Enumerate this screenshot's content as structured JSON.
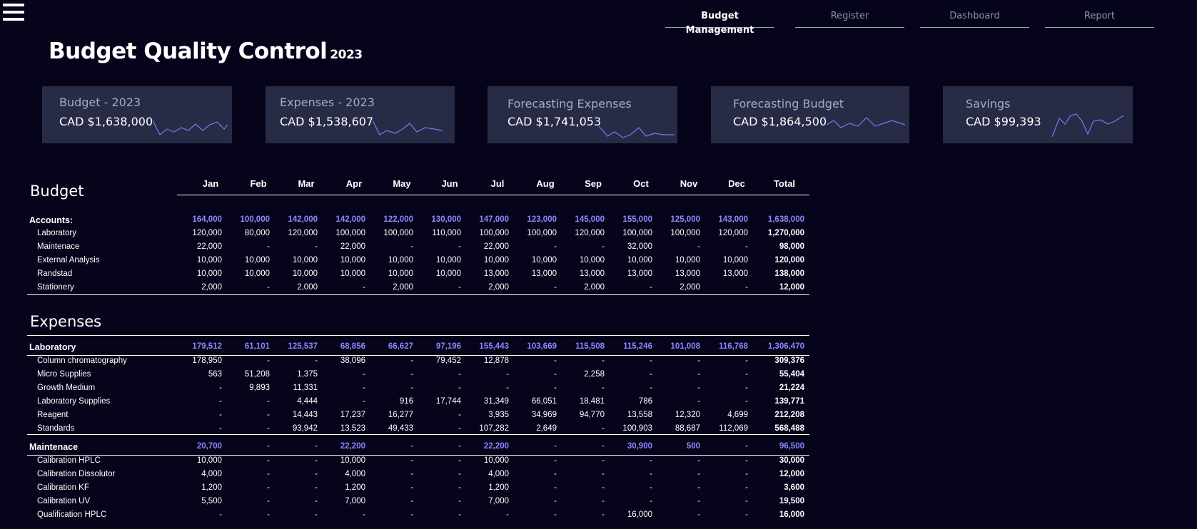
{
  "nav": [
    "Budget Management",
    "Register",
    "Dashboard",
    "Report"
  ],
  "title": "Budget Quality Control",
  "title_year": "2023",
  "accent_color": "#8c89ff",
  "kpis": [
    {
      "label": "Budget - 2023",
      "value": "CAD $1,638,000"
    },
    {
      "label": "Expenses - 2023",
      "value": "CAD $1,538,607"
    },
    {
      "label": "Forecasting Expenses",
      "value": "CAD $1,741,053"
    },
    {
      "label": "Forecasting Budget",
      "value": "CAD $1,864,500"
    },
    {
      "label": "Savings",
      "value": "CAD $99,393"
    }
  ],
  "months": [
    "Jan",
    "Feb",
    "Mar",
    "Apr",
    "May",
    "Jun",
    "Jul",
    "Aug",
    "Sep",
    "Oct",
    "Nov",
    "Dec",
    "Total"
  ],
  "budget": {
    "title": "Budget",
    "groups": [
      {
        "label": "Accounts:",
        "values": [
          "164,000",
          "100,000",
          "142,000",
          "142,000",
          "122,000",
          "130,000",
          "147,000",
          "123,000",
          "145,000",
          "155,000",
          "125,000",
          "143,000",
          "1,638,000"
        ],
        "rows": [
          {
            "label": "Laboratory",
            "values": [
              "120,000",
              "80,000",
              "120,000",
              "100,000",
              "100,000",
              "110,000",
              "100,000",
              "100,000",
              "120,000",
              "100,000",
              "100,000",
              "120,000",
              "1,270,000"
            ]
          },
          {
            "label": "Maintenace",
            "values": [
              "22,000",
              "-",
              "-",
              "22,000",
              "-",
              "-",
              "22,000",
              "-",
              "-",
              "32,000",
              "-",
              "-",
              "98,000"
            ]
          },
          {
            "label": "External Analysis",
            "values": [
              "10,000",
              "10,000",
              "10,000",
              "10,000",
              "10,000",
              "10,000",
              "10,000",
              "10,000",
              "10,000",
              "10,000",
              "10,000",
              "10,000",
              "120,000"
            ]
          },
          {
            "label": "Randstad",
            "values": [
              "10,000",
              "10,000",
              "10,000",
              "10,000",
              "10,000",
              "10,000",
              "13,000",
              "13,000",
              "13,000",
              "13,000",
              "13,000",
              "13,000",
              "138,000"
            ]
          },
          {
            "label": "Stationery",
            "values": [
              "2,000",
              "-",
              "2,000",
              "-",
              "2,000",
              "-",
              "2,000",
              "-",
              "2,000",
              "-",
              "2,000",
              "-",
              "12,000"
            ]
          }
        ]
      }
    ]
  },
  "expenses": {
    "title": "Expenses",
    "groups": [
      {
        "label": "Laboratory",
        "values": [
          "179,512",
          "61,101",
          "125,537",
          "68,856",
          "66,627",
          "97,196",
          "155,443",
          "103,669",
          "115,508",
          "115,246",
          "101,008",
          "116,768",
          "1,306,470"
        ],
        "rows": [
          {
            "label": "Column chromatography",
            "values": [
              "178,950",
              "-",
              "-",
              "38,096",
              "-",
              "79,452",
              "12,878",
              "-",
              "-",
              "-",
              "-",
              "-",
              "309,376"
            ]
          },
          {
            "label": "Micro Supplies",
            "values": [
              "563",
              "51,208",
              "1,375",
              "-",
              "-",
              "-",
              "-",
              "-",
              "2,258",
              "-",
              "-",
              "-",
              "55,404"
            ]
          },
          {
            "label": "Growth Medium",
            "values": [
              "-",
              "9,893",
              "11,331",
              "-",
              "-",
              "-",
              "-",
              "-",
              "-",
              "-",
              "-",
              "-",
              "21,224"
            ]
          },
          {
            "label": "Laboratory Supplies",
            "values": [
              "-",
              "-",
              "4,444",
              "-",
              "916",
              "17,744",
              "31,349",
              "66,051",
              "18,481",
              "786",
              "-",
              "-",
              "139,771"
            ]
          },
          {
            "label": "Reagent",
            "values": [
              "-",
              "-",
              "14,443",
              "17,237",
              "16,277",
              "-",
              "3,935",
              "34,969",
              "94,770",
              "13,558",
              "12,320",
              "4,699",
              "212,208"
            ]
          },
          {
            "label": "Standards",
            "values": [
              "-",
              "-",
              "93,942",
              "13,523",
              "49,433",
              "-",
              "107,282",
              "2,649",
              "-",
              "100,903",
              "88,687",
              "112,069",
              "568,488"
            ]
          }
        ]
      },
      {
        "label": "Maintenace",
        "values": [
          "20,700",
          "-",
          "-",
          "22,200",
          "-",
          "-",
          "22,200",
          "-",
          "-",
          "30,900",
          "500",
          "-",
          "96,500"
        ],
        "rows": [
          {
            "label": "Calibration HPLC",
            "values": [
              "10,000",
              "-",
              "-",
              "10,000",
              "-",
              "-",
              "10,000",
              "-",
              "-",
              "-",
              "-",
              "-",
              "30,000"
            ]
          },
          {
            "label": "Calibration Dissolutor",
            "values": [
              "4,000",
              "-",
              "-",
              "4,000",
              "-",
              "-",
              "4,000",
              "-",
              "-",
              "-",
              "-",
              "-",
              "12,000"
            ]
          },
          {
            "label": "Calibration KF",
            "values": [
              "1,200",
              "-",
              "-",
              "1,200",
              "-",
              "-",
              "1,200",
              "-",
              "-",
              "-",
              "-",
              "-",
              "3,600"
            ]
          },
          {
            "label": "Calibration UV",
            "values": [
              "5,500",
              "-",
              "-",
              "7,000",
              "-",
              "-",
              "7,000",
              "-",
              "-",
              "-",
              "-",
              "-",
              "19,500"
            ]
          },
          {
            "label": "Qualification HPLC",
            "values": [
              "-",
              "-",
              "-",
              "-",
              "-",
              "-",
              "-",
              "-",
              "-",
              "16,000",
              "-",
              "-",
              "16,000"
            ]
          }
        ]
      }
    ]
  }
}
